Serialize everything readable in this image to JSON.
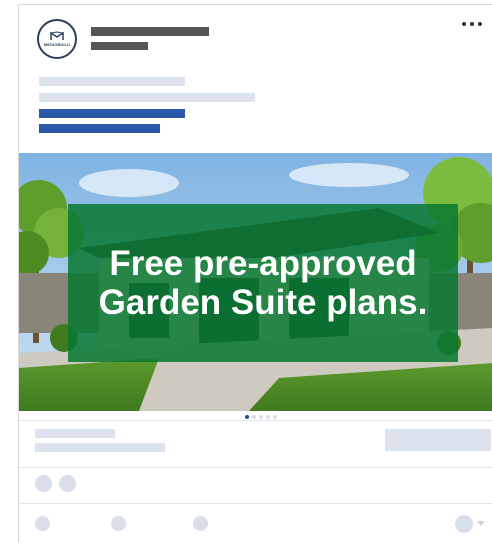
{
  "ad": {
    "advertiser": {
      "logo_text": "MEDIOBUILD",
      "logo_icon": "house-roof-icon"
    },
    "menu_icon": "more-horizontal-icon",
    "image_headline": "Free pre-approved Garden Suite plans.",
    "carousel": {
      "count": 5,
      "active_index": 0
    },
    "colors": {
      "overlay": "#087832",
      "link_placeholder": "#2b58a8",
      "placeholder": "#dde3ee",
      "header_placeholder": "#555555"
    }
  }
}
